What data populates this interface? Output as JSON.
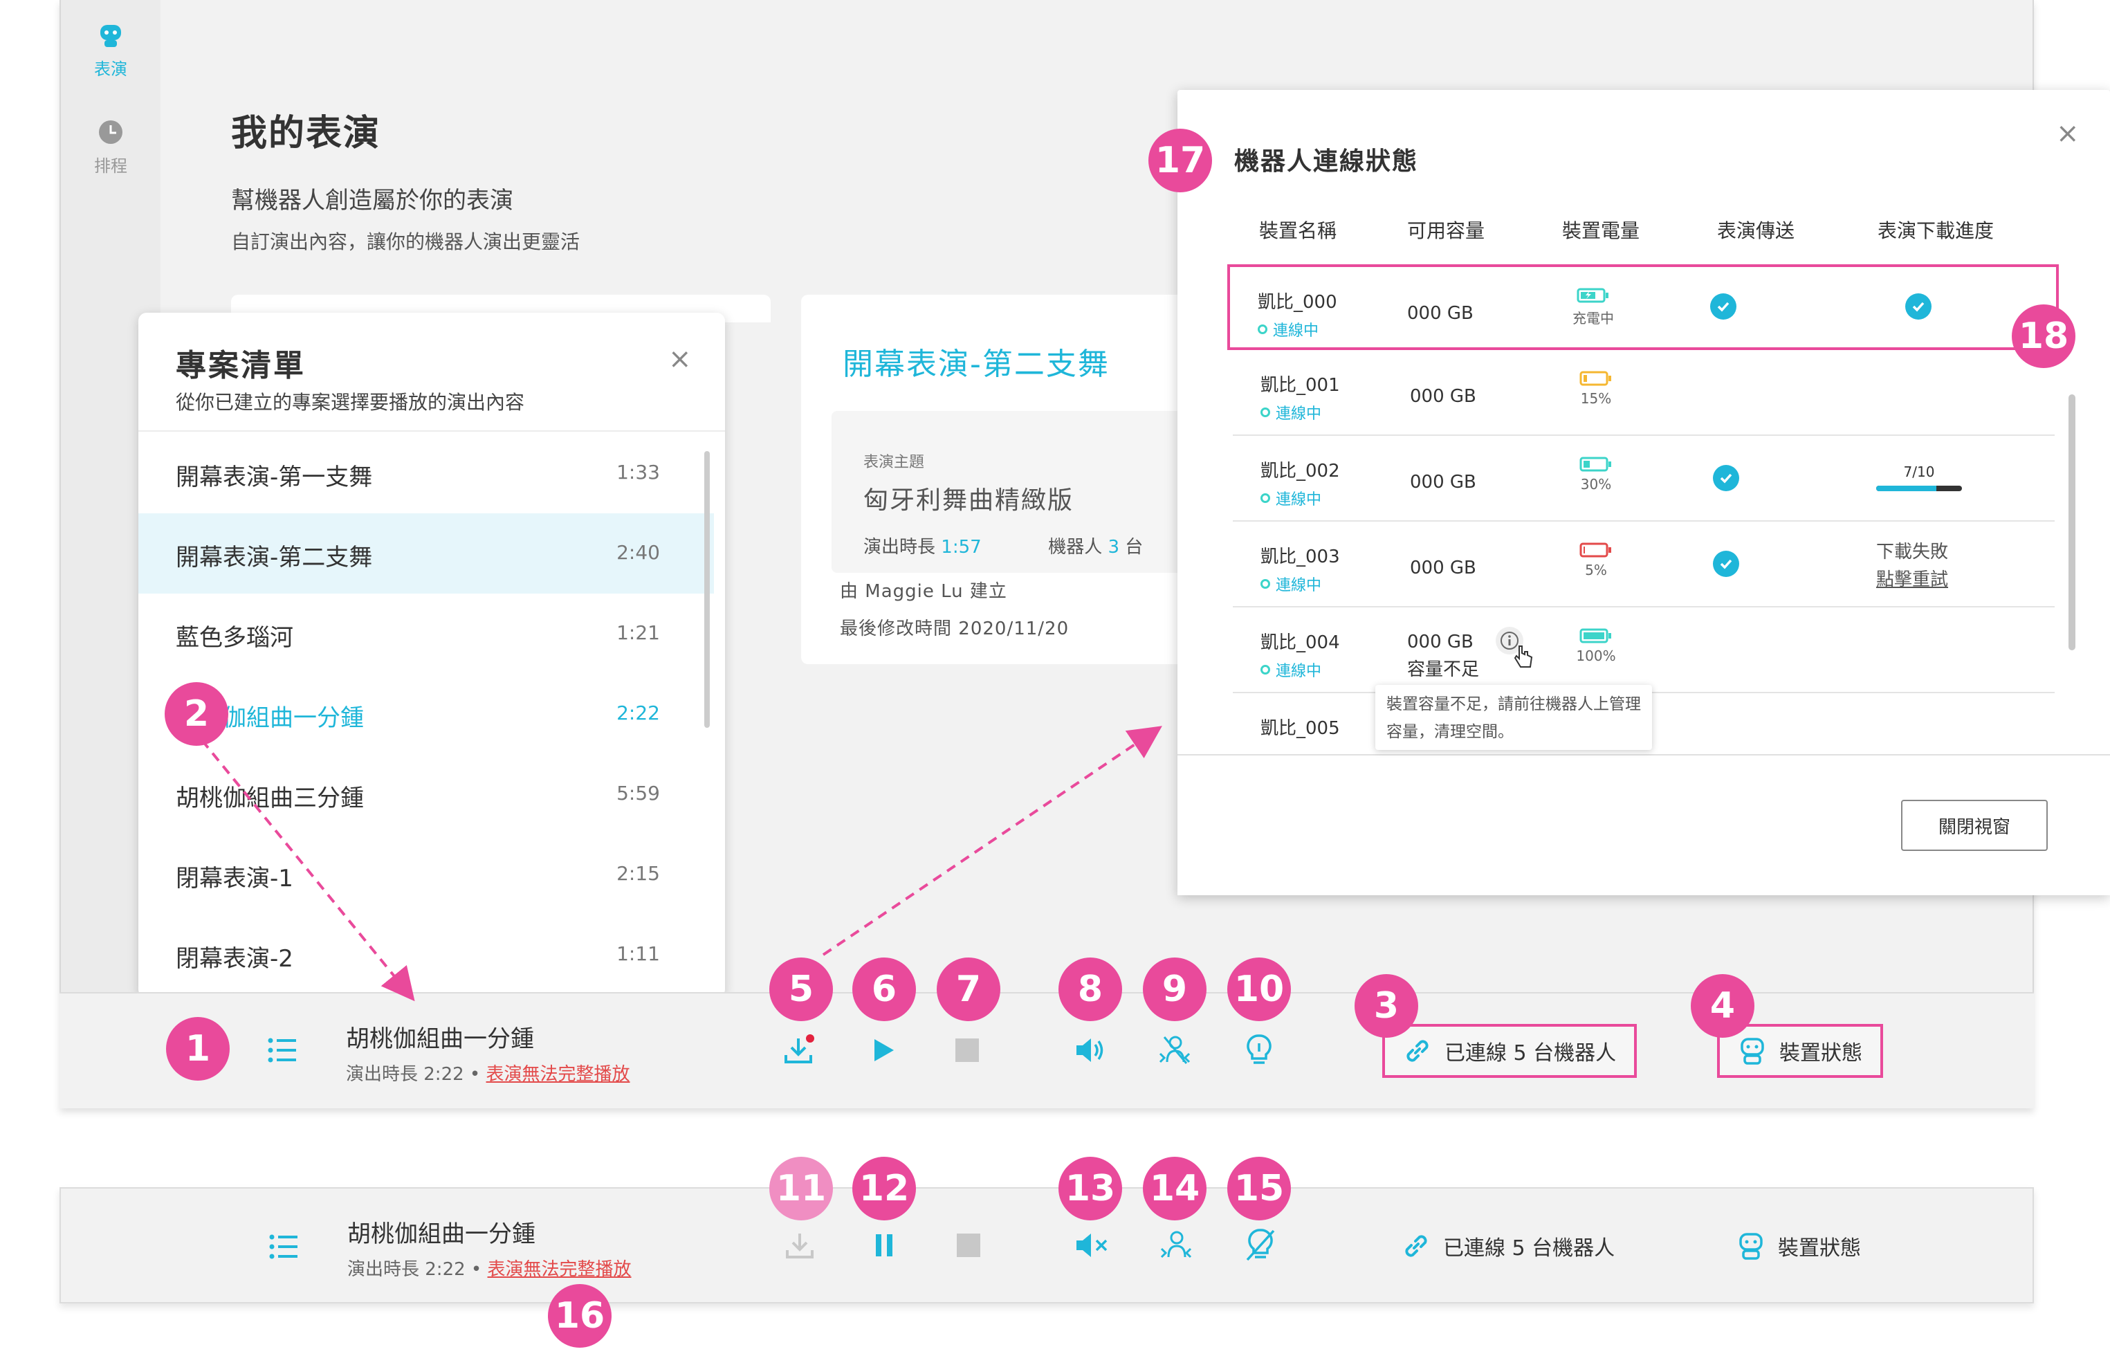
{
  "sidebar": {
    "items": [
      {
        "label": "表演",
        "icon": "robot-icon",
        "active": true
      },
      {
        "label": "排程",
        "icon": "clock-icon",
        "active": false
      }
    ]
  },
  "page": {
    "title": "我的表演",
    "subtitle": "幫機器人創造屬於你的表演",
    "description": "自訂演出內容，讓你的機器人演出更靈活"
  },
  "detail": {
    "title": "開幕表演-第二支舞",
    "theme_label": "表演主題",
    "theme": "匈牙利舞曲精緻版",
    "duration_label": "演出時長",
    "duration": "1:57",
    "robots_label": "機器人",
    "robots_count": "3",
    "robots_unit": "台",
    "created_by": "由 Maggie Lu 建立",
    "modified_label": "最後修改時間",
    "modified_date": "2020/11/20"
  },
  "project_list": {
    "title": "專案清單",
    "subtitle": "從你已建立的專案選擇要播放的演出內容",
    "close": "×",
    "items": [
      {
        "name": "開幕表演-第一支舞",
        "time": "1:33"
      },
      {
        "name": "開幕表演-第二支舞",
        "time": "2:40"
      },
      {
        "name": "藍色多瑙河",
        "time": "1:21"
      },
      {
        "name": "胡桃伽組曲一分鍾",
        "time": "2:22"
      },
      {
        "name": "胡桃伽組曲三分鍾",
        "time": "5:59"
      },
      {
        "name": "閉幕表演-1",
        "time": "2:15"
      },
      {
        "name": "閉幕表演-2",
        "time": "1:11"
      }
    ],
    "selected_index": 1,
    "active_index": 3
  },
  "player": {
    "song": "胡桃伽組曲一分鍾",
    "duration_label": "演出時長 2:22",
    "separator": "•",
    "warning": "表演無法完整播放",
    "connected": "已連線 5 台機器人",
    "device_status": "裝置狀態"
  },
  "modal": {
    "title": "機器人連線狀態",
    "close": "×",
    "columns": [
      "裝置名稱",
      "可用容量",
      "裝置電量",
      "表演傳送",
      "表演下載進度"
    ],
    "rows": [
      {
        "name": "凱比_000",
        "status": "連線中",
        "capacity": "000 GB",
        "battery_label": "充電中",
        "battery_level": 0.7,
        "battery_color": "#3cd4c9",
        "charging": true,
        "sent": true,
        "progress": "check"
      },
      {
        "name": "凱比_001",
        "status": "連線中",
        "capacity": "000 GB",
        "battery_label": "15%",
        "battery_level": 0.15,
        "battery_color": "#f5b731",
        "charging": false,
        "sent": false,
        "progress": ""
      },
      {
        "name": "凱比_002",
        "status": "連線中",
        "capacity": "000 GB",
        "battery_label": "30%",
        "battery_level": 0.3,
        "battery_color": "#3cd4c9",
        "charging": false,
        "sent": true,
        "progress": "7/10",
        "progress_value": 0.7
      },
      {
        "name": "凱比_003",
        "status": "連線中",
        "capacity": "000 GB",
        "battery_label": "5%",
        "battery_level": 0.05,
        "battery_color": "#e34a4a",
        "charging": false,
        "sent": true,
        "progress": "fail",
        "fail_text": "下載失敗",
        "retry_text": "點擊重試"
      },
      {
        "name": "凱比_004",
        "status": "連線中",
        "capacity": "000 GB",
        "capacity_note": "容量不足",
        "battery_label": "100%",
        "battery_level": 1.0,
        "battery_color": "#3cd4c9",
        "charging": false,
        "sent": false,
        "progress": ""
      },
      {
        "name": "凱比_005",
        "status": "",
        "capacity": "",
        "battery_label": "",
        "sent": false,
        "progress": ""
      }
    ],
    "tooltip": "裝置容量不足，請前往機器人上管理容量，清理空間。",
    "close_button": "關閉視窗"
  },
  "markers": [
    "1",
    "2",
    "3",
    "4",
    "5",
    "6",
    "7",
    "8",
    "9",
    "10",
    "11",
    "12",
    "13",
    "14",
    "15",
    "16",
    "17",
    "18"
  ],
  "colors": {
    "accent": "#1fb6d9",
    "marker": "#e94a9b",
    "warning": "#e34a4a"
  }
}
